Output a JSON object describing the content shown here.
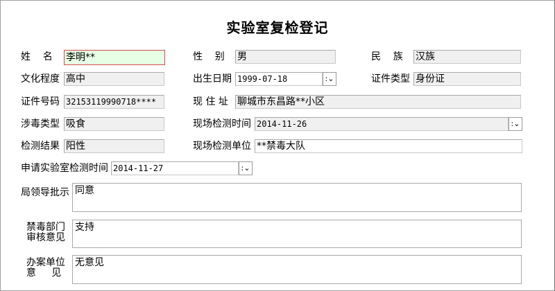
{
  "title": "实验室复检登记",
  "fields": {
    "name": {
      "label": "姓    名",
      "value": "李明**"
    },
    "gender": {
      "label": "性    别",
      "value": "男"
    },
    "ethnicity": {
      "label": "民    族",
      "value": "汉族"
    },
    "education": {
      "label": "文化程度",
      "value": "高中"
    },
    "birth_date": {
      "label": "出生日期",
      "value": "1999-07-18"
    },
    "id_type": {
      "label": "证件类型",
      "value": "身份证"
    },
    "id_number": {
      "label": "证件号码",
      "value": "32153119990718****"
    },
    "address": {
      "label": "现 住 址",
      "value": "聊城市东昌路**小区"
    },
    "drug_type": {
      "label": "涉毒类型",
      "value": "吸食"
    },
    "field_test_time": {
      "label": "现场检测时间",
      "value": "2014-11-26"
    },
    "test_result": {
      "label": "检测结果",
      "value": "阳性"
    },
    "field_test_unit": {
      "label": "现场检测单位",
      "value": "**禁毒大队"
    },
    "lab_request_time": {
      "label": "申请实验室检测时间",
      "value": "2014-11-27"
    },
    "leader_instruction": {
      "label": "局领导批示",
      "value": "同意"
    },
    "dept_review": {
      "label_line1": "禁毒部门",
      "label_line2": "审核意见",
      "value": "支持"
    },
    "case_unit_opinion": {
      "label_line1": "办案单位",
      "label_line2": "意    见",
      "value": "无意见"
    }
  },
  "spin_glyph": ":",
  "dropdown_glyph": "⌄"
}
